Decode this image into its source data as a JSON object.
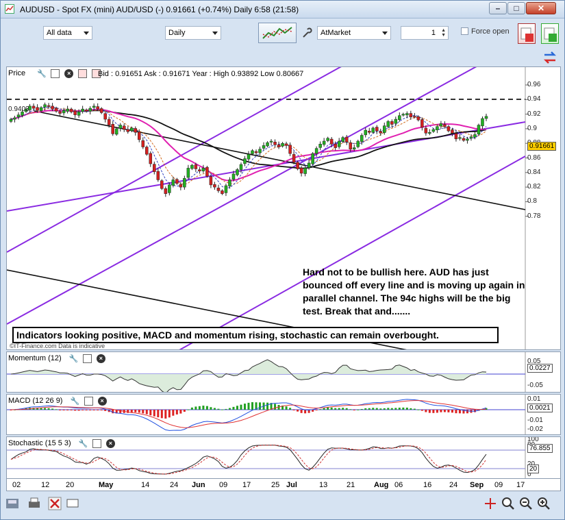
{
  "window": {
    "title": "AUDUSD - Spot FX (mini) AUD/USD (-)    0.91661 (+0.74%)    Daily  6:58 (21:58)"
  },
  "toolbar": {
    "range": "All data",
    "period": "Daily",
    "order_type": "AtMarket",
    "quantity": "1",
    "force_open_label": "Force open",
    "force_open_checked": false
  },
  "price_pane": {
    "label": "Price",
    "quote": "Bid : 0.91651  Ask : 0.91671   Year : High 0.93892  Low 0.80667",
    "level_label": "0.9403",
    "current_price": "0.91661",
    "ticks": [
      "0.96",
      "0.94",
      "0.92",
      "0.9",
      "0.88",
      "0.86",
      "0.84",
      "0.82",
      "0.8",
      "0.78"
    ],
    "annotation": "Hard not to be bullish here. AUD has just bounced off every line and is moving up again in parallel channel. The 94c highs will be the big test. Break that and.......",
    "indicator_note": "Indicators looking positive, MACD and momentum rising, stochastic can remain overbought.",
    "source": "©IT-Finance.com  Data is indicative"
  },
  "momentum_pane": {
    "label": "Momentum (12)",
    "ticks": [
      "0.05",
      "-0.05"
    ],
    "value": "0.0227"
  },
  "macd_pane": {
    "label": "MACD (12 26 9)",
    "ticks": [
      "0.01",
      "-0.01",
      "-0.02"
    ],
    "value": "0.0021"
  },
  "stoch_pane": {
    "label": "Stochastic (15 5 3)",
    "ticks": [
      "100",
      "80",
      "20",
      "0"
    ],
    "value": "76.855",
    "lower_value": "20"
  },
  "date_axis": [
    {
      "t": "02",
      "m": false
    },
    {
      "t": "12",
      "m": false
    },
    {
      "t": "20",
      "m": false
    },
    {
      "t": "May",
      "m": true
    },
    {
      "t": "14",
      "m": false
    },
    {
      "t": "24",
      "m": false
    },
    {
      "t": "Jun",
      "m": true
    },
    {
      "t": "09",
      "m": false
    },
    {
      "t": "17",
      "m": false
    },
    {
      "t": "25",
      "m": false
    },
    {
      "t": "Jul",
      "m": true
    },
    {
      "t": "13",
      "m": false
    },
    {
      "t": "21",
      "m": false
    },
    {
      "t": "Aug",
      "m": true
    },
    {
      "t": "06",
      "m": false
    },
    {
      "t": "16",
      "m": false
    },
    {
      "t": "24",
      "m": false
    },
    {
      "t": "Sep",
      "m": true
    },
    {
      "t": "09",
      "m": false
    },
    {
      "t": "17",
      "m": false
    }
  ],
  "chart_data": {
    "type": "candlestick",
    "ylim": [
      0.78,
      0.97
    ],
    "closes": [
      0.913,
      0.915,
      0.919,
      0.923,
      0.927,
      0.931,
      0.928,
      0.925,
      0.929,
      0.933,
      0.931,
      0.927,
      0.924,
      0.921,
      0.925,
      0.927,
      0.923,
      0.919,
      0.923,
      0.927,
      0.924,
      0.928,
      0.931,
      0.927,
      0.922,
      0.913,
      0.905,
      0.893,
      0.9,
      0.905,
      0.899,
      0.896,
      0.901,
      0.895,
      0.885,
      0.875,
      0.865,
      0.852,
      0.841,
      0.83,
      0.818,
      0.811,
      0.823,
      0.83,
      0.825,
      0.82,
      0.832,
      0.846,
      0.85,
      0.845,
      0.842,
      0.846,
      0.835,
      0.823,
      0.82,
      0.815,
      0.811,
      0.822,
      0.83,
      0.838,
      0.844,
      0.851,
      0.859,
      0.865,
      0.87,
      0.867,
      0.872,
      0.877,
      0.881,
      0.883,
      0.878,
      0.875,
      0.88,
      0.877,
      0.866,
      0.854,
      0.845,
      0.839,
      0.846,
      0.853,
      0.866,
      0.873,
      0.879,
      0.883,
      0.887,
      0.879,
      0.874,
      0.883,
      0.888,
      0.882,
      0.872,
      0.874,
      0.883,
      0.891,
      0.898,
      0.895,
      0.901,
      0.897,
      0.894,
      0.904,
      0.91,
      0.906,
      0.913,
      0.918,
      0.92,
      0.921,
      0.916,
      0.917,
      0.912,
      0.902,
      0.894,
      0.895,
      0.899,
      0.903,
      0.907,
      0.903,
      0.897,
      0.894,
      0.886,
      0.888,
      0.884,
      0.886,
      0.889,
      0.892,
      0.905,
      0.914,
      0.917
    ]
  }
}
